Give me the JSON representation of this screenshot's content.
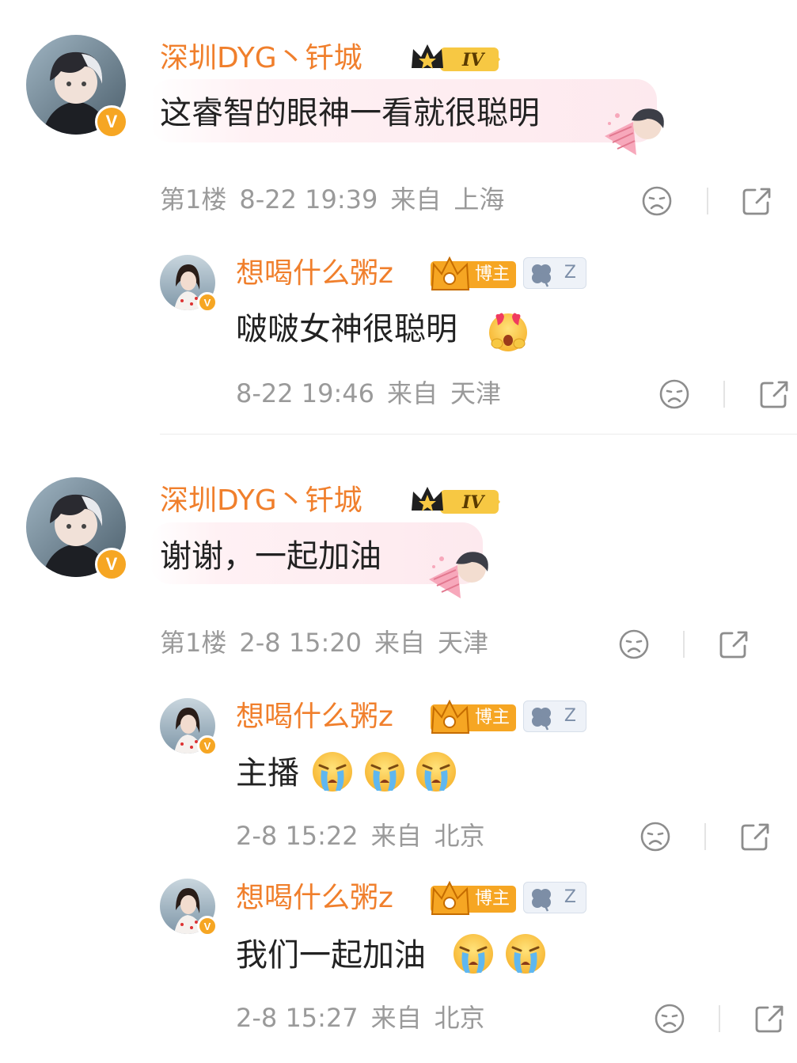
{
  "threads": [
    {
      "comment": {
        "user": "深圳DYG丶钎城",
        "level": "IV",
        "text": "这睿智的眼神一看就很聪明",
        "floor": "第1楼",
        "time": "8-22 19:39",
        "from": "来自",
        "location": "上海"
      },
      "replies": [
        {
          "user": "想喝什么粥z",
          "badge": "博主",
          "clover_tag": "Z",
          "text": "啵啵女神很聪明",
          "emoji": [
            "heart-eyes"
          ],
          "time": "8-22 19:46",
          "from": "来自",
          "location": "天津"
        }
      ]
    },
    {
      "comment": {
        "user": "深圳DYG丶钎城",
        "level": "IV",
        "text": "谢谢，一起加油",
        "floor": "第1楼",
        "time": "2-8 15:20",
        "from": "来自",
        "location": "天津"
      },
      "replies": [
        {
          "user": "想喝什么粥z",
          "badge": "博主",
          "clover_tag": "Z",
          "text": "主播",
          "emoji": [
            "crying",
            "crying",
            "crying"
          ],
          "time": "2-8 15:22",
          "from": "来自",
          "location": "北京"
        },
        {
          "user": "想喝什么粥z",
          "badge": "博主",
          "clover_tag": "Z",
          "text": "我们一起加油",
          "emoji": [
            "crying",
            "crying"
          ],
          "time": "2-8 15:27",
          "from": "来自",
          "location": "北京"
        }
      ]
    }
  ],
  "icons": {
    "dislike": "sad-face-icon",
    "share": "share-icon",
    "verified": "verified-v-icon",
    "crown": "crown-icon",
    "clover": "clover-icon"
  },
  "colors": {
    "username": "#f07f2c",
    "meta": "#9a9a9a",
    "badge": "#f6a623",
    "bubble": "#fde9ee"
  }
}
